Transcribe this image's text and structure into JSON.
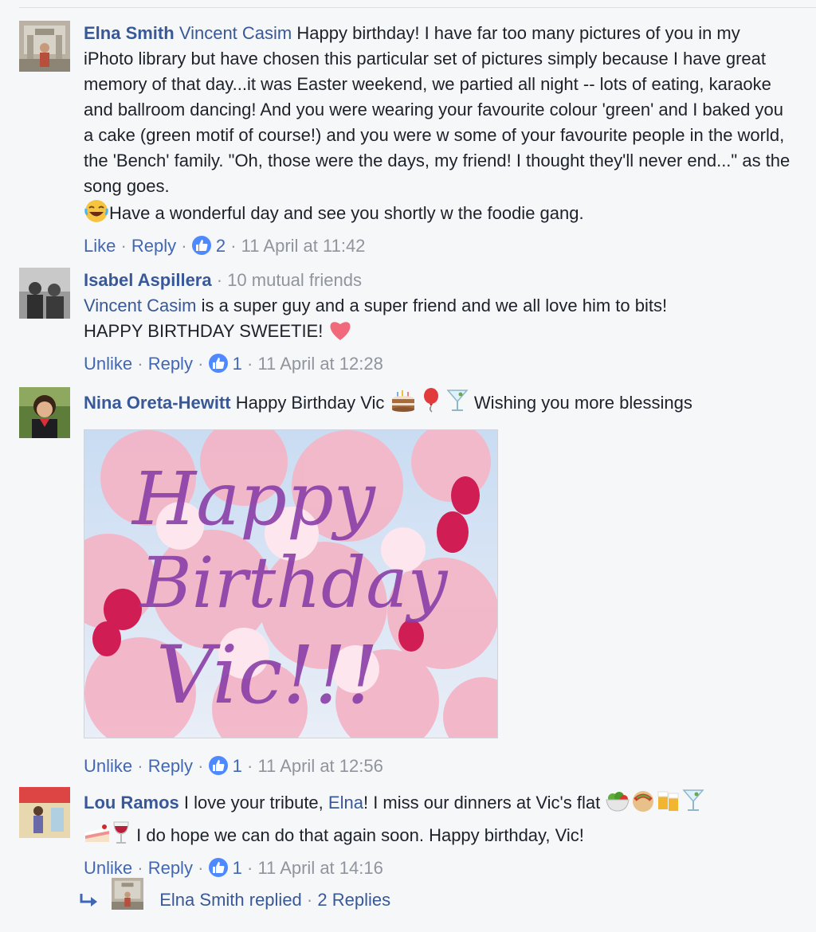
{
  "comments": [
    {
      "author": "Elna Smith",
      "tag": "Vincent Casim",
      "text": "Happy birthday! I have far too many pictures of you in my iPhoto library but have chosen this particular set of pictures simply because I have great memory of that day...it was Easter weekend, we partied all night -- lots of eating, karaoke and ballroom dancing! And you were wearing your favourite colour 'green' and I baked you a cake (green motif of course!) and you were w some of your favourite people in the world, the 'Bench' family. \"Oh, those were the days, my friend! I thought they'll never end...\" as the song goes.",
      "text2": "Have a wonderful day and see you shortly w the foodie gang.",
      "like_label": "Like",
      "reply_label": "Reply",
      "like_count": "2",
      "timestamp": "11 April at 11:42"
    },
    {
      "author": "Isabel Aspillera",
      "mutual": "10 mutual friends",
      "tag": "Vincent Casim",
      "text": "is a super guy and a super friend and we all love him to bits!",
      "text2": "HAPPY BIRTHDAY SWEETIE!",
      "like_label": "Unlike",
      "reply_label": "Reply",
      "like_count": "1",
      "timestamp": "11 April at 12:28"
    },
    {
      "author": "Nina Oreta-Hewitt",
      "text": "Happy Birthday Vic",
      "text2": "Wishing you more blessings",
      "image_text": [
        "Happy",
        "Birthday",
        "Vic!!!"
      ],
      "like_label": "Unlike",
      "reply_label": "Reply",
      "like_count": "1",
      "timestamp": "11 April at 12:56"
    },
    {
      "author": "Lou Ramos",
      "text": "I love your tribute,",
      "tag": "Elna",
      "text2": "! I miss our dinners at Vic's flat",
      "text3": "I do hope we can do that again soon. Happy birthday, Vic!",
      "like_label": "Unlike",
      "reply_label": "Reply",
      "like_count": "1",
      "timestamp": "11 April at 14:16"
    }
  ],
  "replies": {
    "author": "Elna Smith replied",
    "count": "2 Replies"
  },
  "colors": {
    "link": "#385898",
    "muted": "#90949c",
    "like_badge": "#4f89ff",
    "background": "#f6f7f9"
  },
  "icons": [
    "like-thumb-icon",
    "laughing-emoji-icon",
    "heart-emoji-icon",
    "cake-emoji-icon",
    "balloon-emoji-icon",
    "cocktail-emoji-icon",
    "salad-emoji-icon",
    "taco-emoji-icon",
    "beer-emoji-icon",
    "cake-slice-emoji-icon",
    "wine-emoji-icon",
    "reply-arrow-icon"
  ]
}
